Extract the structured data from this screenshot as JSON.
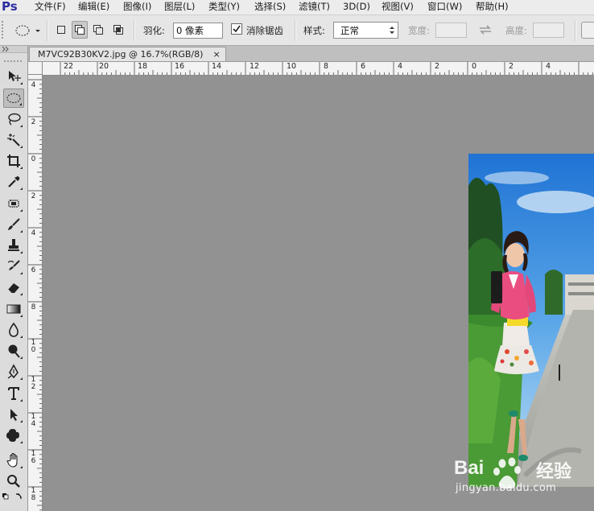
{
  "app": {
    "logo": "Ps"
  },
  "menu": [
    "文件(F)",
    "编辑(E)",
    "图像(I)",
    "图层(L)",
    "类型(Y)",
    "选择(S)",
    "滤镜(T)",
    "3D(D)",
    "视图(V)",
    "窗口(W)",
    "帮助(H)"
  ],
  "options": {
    "feather_label": "羽化:",
    "feather_value": "0 像素",
    "antialias_label": "消除锯齿",
    "antialias_checked": true,
    "style_label": "样式:",
    "style_value": "正常",
    "width_label": "宽度:",
    "height_label": "高度:"
  },
  "document": {
    "tab_title": "M7VC92B30KV2.jpg @ 16.7%(RGB/8)",
    "close_glyph": "×"
  },
  "rulers": {
    "horizontal": [
      "22",
      "20",
      "18",
      "16",
      "14",
      "12",
      "10",
      "8",
      "6",
      "4",
      "2",
      "0",
      "2",
      "4"
    ],
    "vertical": [
      "4",
      "2",
      "0",
      "2",
      "4",
      "6",
      "8",
      "10",
      "12",
      "14",
      "16",
      "18"
    ]
  },
  "tools": [
    "move-tool",
    "elliptical-marquee-tool",
    "lasso-tool",
    "quick-selection-tool",
    "crop-tool",
    "eyedropper-tool",
    "spot-healing-tool",
    "brush-tool",
    "clone-stamp-tool",
    "history-brush-tool",
    "eraser-tool",
    "gradient-tool",
    "blur-tool",
    "dodge-tool",
    "pen-tool",
    "type-tool",
    "path-selection-tool",
    "custom-shape-tool",
    "hand-tool",
    "zoom-tool"
  ],
  "watermark": {
    "brand_left": "Bai",
    "brand_right": "经验",
    "url": "jingyan.baidu.com"
  },
  "colors": {
    "canvas": "#929292",
    "panel": "#dcdcdc",
    "logo": "#2c2ea0"
  }
}
